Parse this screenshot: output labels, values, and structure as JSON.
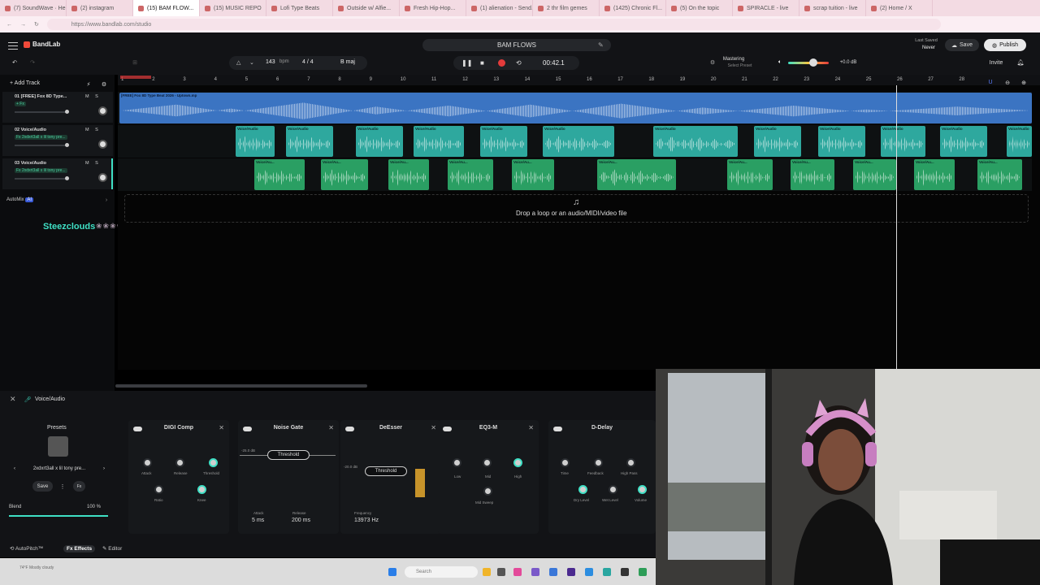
{
  "browser": {
    "tabs": [
      "(7) SoundWave · Help",
      "(2) instagram",
      "(15) BAM FLOW...",
      "(15) MUSIC REPO",
      "Lofi Type Beats",
      "Outside w/ Alfie...",
      "Fresh Hip-Hop...",
      "(1) alienation - Send...",
      "2 thr film gemes",
      "(1425) Chronic Fl...",
      "(5) On the topic",
      "SPIRACLE - live",
      "scrap tuition - live",
      "(2) Home / X"
    ],
    "url": "https://www.bandlab.com/studio"
  },
  "header": {
    "app_name": "BandLab",
    "project_title": "BAM FLOWS",
    "last_saved_label": "Last Saved",
    "last_saved_value": "Never",
    "save_label": "Save",
    "publish_label": "Publish",
    "invite_label": "Invite",
    "bpm": "143",
    "bpm_unit": "bpm",
    "time_signature": "4 / 4",
    "key": "B maj",
    "time": "00:42.1",
    "mastering_label": "Mastering",
    "mastering_sub": "Select Preset",
    "master_db": "+0.0 dB"
  },
  "tracks": {
    "add_track_label": "Add Track",
    "items": [
      {
        "name": "01  [FREE] Fox 8D Type...",
        "fx": "+ Fx",
        "ms": "M S"
      },
      {
        "name": "02  Voice/Audio",
        "fx": "Fx 2xdxrt3all x lil tony pre...",
        "ms": "M S"
      },
      {
        "name": "03  Voice/Audio",
        "fx": "Fx 2xdxrt3all x lil tony pre...",
        "ms": "M S"
      }
    ],
    "automix_label": "AutoMix",
    "automix_badge": "AI",
    "overlay_name": "Steezclouds",
    "overlay_emotes": "❀❀❀❀❀"
  },
  "ruler": [
    "1",
    "2",
    "3",
    "4",
    "5",
    "6",
    "7",
    "8",
    "9",
    "10",
    "11",
    "12",
    "13",
    "14",
    "15",
    "16",
    "17",
    "18",
    "19",
    "20",
    "21",
    "22",
    "23",
    "24",
    "25",
    "26",
    "27",
    "28"
  ],
  "lane1_clip_label": "[FREE] Fox 8D Type Beat 2026 - Uptown.mp",
  "clip_label": "Voice/Audio",
  "clip_label_b": "Voice/Au...",
  "drop_text": "Drop a loop or an audio/MIDI/video file",
  "fx_panel": {
    "track_title": "Voice/Audio",
    "presets_label": "Presets",
    "preset_name": "2xdxrt3all x lil tony pre...",
    "save_label": "Save",
    "fx_btn": "Fx",
    "blend_label": "Blend",
    "blend_value": "100 %",
    "cards": [
      {
        "title": "DIGI Comp",
        "knobs": [
          "Attack",
          "Release",
          "Threshold",
          "Ratio",
          "Knee"
        ]
      },
      {
        "title": "Noise Gate",
        "gate_db": "-25.0 dB",
        "threshold": "Threshold",
        "attack_label": "Attack",
        "attack": "5 ms",
        "release_label": "Release",
        "release": "200 ms"
      },
      {
        "title": "DeEsser",
        "ess_db": "-20.0 dB",
        "threshold": "Threshold",
        "freq_label": "Frequency",
        "freq": "13973 Hz"
      },
      {
        "title": "EQ3-M",
        "knobs": [
          "Low",
          "Mid",
          "High",
          "Mid Sweep"
        ]
      },
      {
        "title": "D-Delay",
        "knobs": [
          "Time",
          "Feedback",
          "High Pass",
          "Dry Level",
          "Wet Level",
          "Volume"
        ]
      }
    ],
    "bottom_tabs": [
      "AutoPitch™",
      "Effects",
      "Editor"
    ]
  },
  "taskbar": {
    "weather": "74°F Mostly cloudy",
    "search_placeholder": "Search"
  },
  "colors": {
    "accent": "#3fe0c5",
    "lane1": "#3b74c2",
    "lane2": "#2ea89e",
    "lane3": "#2a9f63",
    "record": "#e33b3b"
  }
}
